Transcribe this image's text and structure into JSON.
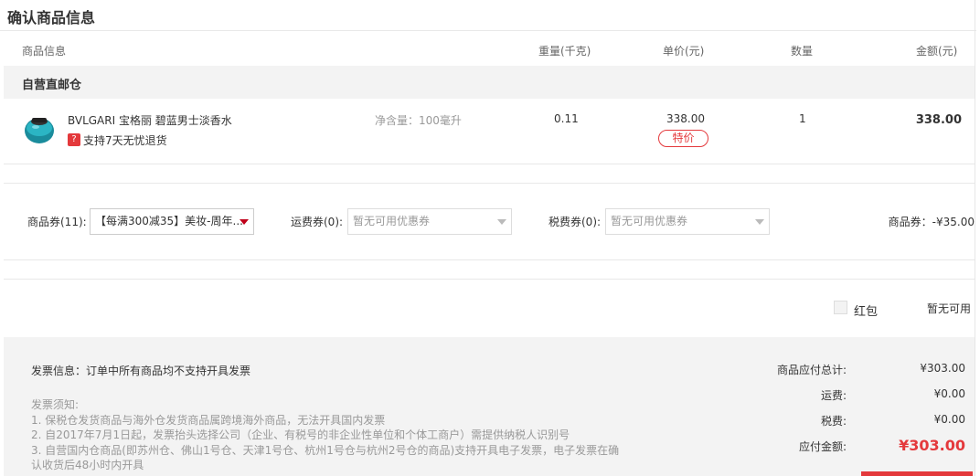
{
  "section_title": "确认商品信息",
  "columns": {
    "product": "商品信息",
    "weight": "重量(千克)",
    "unit_price": "单价(元)",
    "quantity": "数量",
    "amount": "金额(元)"
  },
  "warehouse": "自营直邮仓",
  "product": {
    "name": "BVLGARI 宝格丽 碧蓝男士淡香水",
    "tag_icon": "?",
    "tag_text": "支持7天无忧退货",
    "spec": "净含量：100毫升",
    "weight": "0.11",
    "unit_price": "338.00",
    "badge": "特价",
    "quantity": "1",
    "amount": "338.00"
  },
  "coupons": {
    "product_label": "商品券(11):",
    "product_value": "【每满300减35】美妆-周年...",
    "shipping_label": "运费券(0):",
    "shipping_value": "暂无可用优惠券",
    "tax_label": "税费券(0):",
    "tax_value": "暂无可用优惠券",
    "discount_summary": "商品券：-¥35.00"
  },
  "red_packet": {
    "label": "红包",
    "status": "暂无可用"
  },
  "invoice": {
    "info": "发票信息：订单中所有商品均不支持开具发票",
    "notice_lines": [
      "发票须知:",
      "1. 保税仓发货商品与海外仓发货商品属跨境海外商品，无法开具国内发票",
      "2. 自2017年7月1日起，发票抬头选择公司（企业、有税号的非企业性单位和个体工商户）需提供纳税人识别号",
      "3. 自营国内仓商品(即苏州仓、佛山1号仓、天津1号仓、杭州1号仓与杭州2号仓的商品)支持开具电子发票，电子发票在确",
      "认收货后48小时内开具"
    ]
  },
  "summary": {
    "subtotal_label": "商品应付总计:",
    "subtotal_value": "¥303.00",
    "shipping_label": "运费:",
    "shipping_value": "¥0.00",
    "tax_label": "税费:",
    "tax_value": "¥0.00",
    "payable_label": "应付金额:",
    "payable_value": "¥303.00"
  },
  "colors": {
    "accent": "#e4393c",
    "bar_bg": "#f3f3f3"
  }
}
